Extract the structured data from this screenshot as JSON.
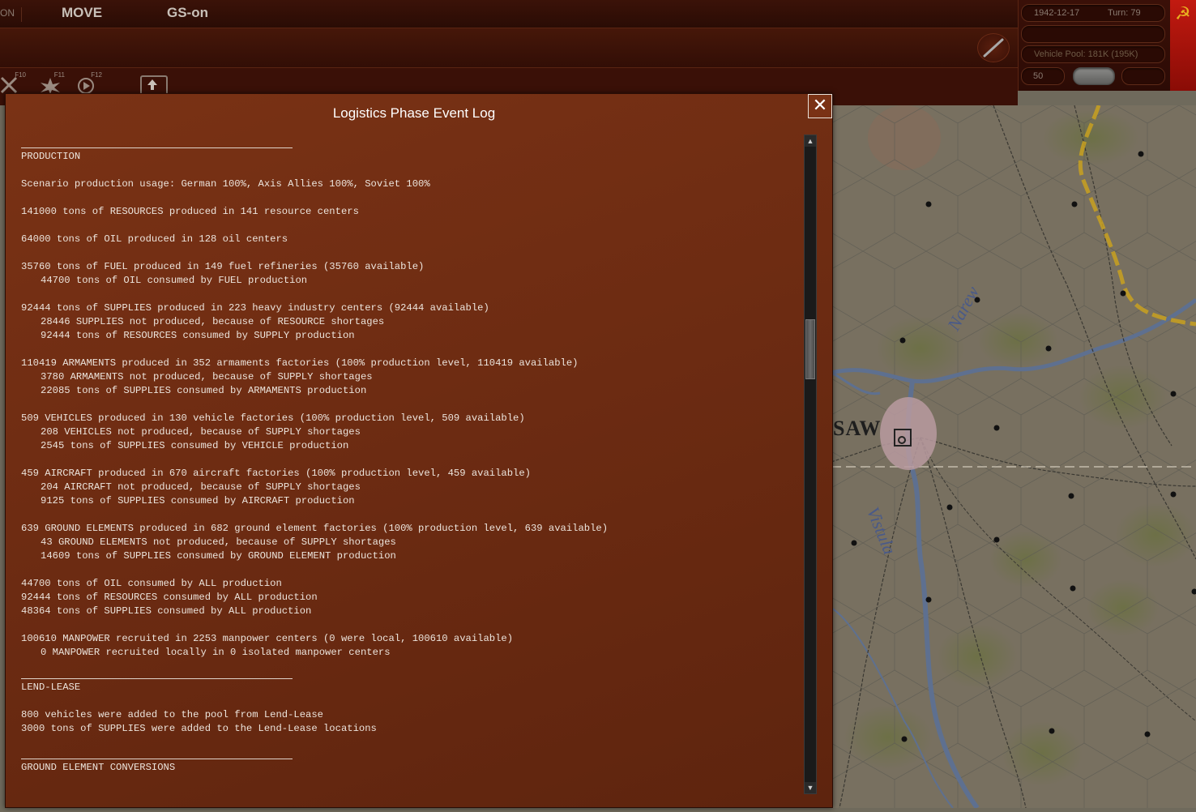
{
  "topbar": {
    "mode_partial": "ON",
    "move": "MOVE",
    "gs": "GS-on"
  },
  "toolbar": {
    "keys": [
      "F10",
      "F11",
      "F12"
    ]
  },
  "info_panel": {
    "date": "1942-12-17",
    "turn": "Turn: 79",
    "vehicle_pool": "Vehicle Pool: 181K (195K)",
    "value_50": "50"
  },
  "flag": {
    "symbol": "☭",
    "color": "#c21a10"
  },
  "map": {
    "city_label": "SAW",
    "rivers": [
      "Narew",
      "Vistula"
    ]
  },
  "dialog": {
    "title": "Logistics Phase Event Log",
    "close_symbol": "✕",
    "sections": [
      {
        "heading": "PRODUCTION",
        "blocks": [
          [
            "Scenario production usage: German 100%, Axis Allies 100%, Soviet 100%"
          ],
          [
            "141000 tons of RESOURCES produced in 141 resource centers"
          ],
          [
            "64000 tons of OIL produced in 128 oil centers"
          ],
          [
            "35760 tons of FUEL produced in 149 fuel refineries (35760 available)",
            "  44700 tons of OIL consumed by FUEL production"
          ],
          [
            "92444 tons of SUPPLIES produced in 223 heavy industry centers (92444 available)",
            "  28446 SUPPLIES not produced, because of RESOURCE shortages",
            "  92444 tons of RESOURCES consumed by SUPPLY production"
          ],
          [
            "110419 ARMAMENTS produced in 352 armaments factories (100% production level, 110419 available)",
            "  3780 ARMAMENTS not produced, because of SUPPLY shortages",
            "  22085 tons of SUPPLIES consumed by ARMAMENTS production"
          ],
          [
            "509 VEHICLES produced in 130 vehicle factories (100% production level, 509 available)",
            "  208 VEHICLES not produced, because of SUPPLY shortages",
            "  2545 tons of SUPPLIES consumed by VEHICLE production"
          ],
          [
            "459 AIRCRAFT produced in 670 aircraft factories (100% production level, 459 available)",
            "  204 AIRCRAFT not produced, because of SUPPLY shortages",
            "  9125 tons of SUPPLIES consumed by AIRCRAFT production"
          ],
          [
            "639 GROUND ELEMENTS produced in 682 ground element factories (100% production level, 639 available)",
            "  43 GROUND ELEMENTS not produced, because of SUPPLY shortages",
            "  14609 tons of SUPPLIES consumed by GROUND ELEMENT production"
          ],
          [
            "44700 tons of OIL consumed by ALL production",
            "92444 tons of RESOURCES consumed by ALL production",
            "48364 tons of SUPPLIES consumed by ALL production"
          ],
          [
            "100610 MANPOWER recruited in 2253 manpower centers (0 were local, 100610 available)",
            "  0 MANPOWER recruited locally in 0 isolated manpower centers"
          ]
        ]
      },
      {
        "heading": "LEND-LEASE",
        "blocks": [
          [
            "800 vehicles were added to the pool from Lend-Lease",
            "3000 tons of SUPPLIES were added to the Lend-Lease locations"
          ]
        ]
      },
      {
        "heading": "GROUND ELEMENT CONVERSIONS",
        "blocks": []
      }
    ]
  },
  "scrollbar": {
    "up": "▲",
    "down": "▼",
    "position_fraction": 0.3
  }
}
